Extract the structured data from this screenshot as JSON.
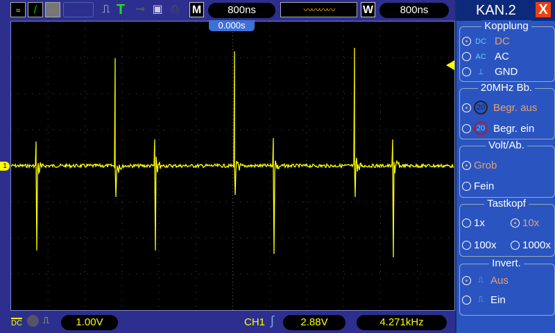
{
  "toolbar": {
    "icons": [
      "channel-waves-icon",
      "line-draw-icon",
      "persistence-icon",
      "blank-slot",
      "pulse-icon",
      "trigger-T-icon",
      "key-icon",
      "save-disk-icon",
      "printer-icon"
    ],
    "mode_label": "M",
    "timebase": "800ns",
    "window_label": "W",
    "window_timebase": "800ns"
  },
  "screen": {
    "trigger_time": "0.000s",
    "ch1_marker": "1"
  },
  "bottom": {
    "coupling": "DC",
    "volts_div": "1.00V",
    "trigger_source": "CH1",
    "trigger_level": "2.88V",
    "frequency": "4.271kHz"
  },
  "panel": {
    "title": "KAN.2",
    "close": "X",
    "kopplung": {
      "label": "Kopplung",
      "options": [
        {
          "icon": "DC",
          "label": "DC",
          "selected": true
        },
        {
          "icon": "AC",
          "label": "AC",
          "selected": false
        },
        {
          "icon": "GND",
          "label": "GND",
          "selected": false
        }
      ]
    },
    "bw": {
      "label": "20MHz  Bb.",
      "options": [
        {
          "icon": "20",
          "label": "Begr.  aus",
          "selected": true
        },
        {
          "icon": "20",
          "label": "Begr.  ein",
          "selected": false
        }
      ]
    },
    "volt": {
      "label": "Volt/Ab.",
      "options": [
        {
          "label": "Grob",
          "selected": true
        },
        {
          "label": "Fein",
          "selected": false
        }
      ]
    },
    "tastkopf": {
      "label": "Tastkopf",
      "options": [
        {
          "label": "1x",
          "selected": false
        },
        {
          "label": "10x",
          "selected": true
        },
        {
          "label": "100x",
          "selected": false
        },
        {
          "label": "1000x",
          "selected": false
        }
      ]
    },
    "invert": {
      "label": "Invert.",
      "options": [
        {
          "label": "Aus",
          "selected": true
        },
        {
          "label": "Ein",
          "selected": false
        }
      ]
    }
  },
  "colors": {
    "trace": "#ffff00",
    "accent": "#e8a070"
  }
}
